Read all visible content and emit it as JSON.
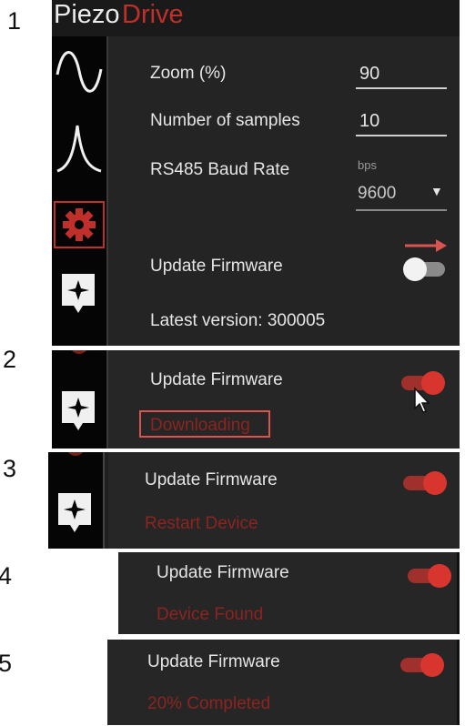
{
  "steps": [
    "1",
    "2",
    "3",
    "4",
    "5"
  ],
  "app": {
    "brand_first": "Piezo",
    "brand_second": "Drive",
    "brand_second_color": "#c0302b"
  },
  "sidebar": {
    "icons": [
      "sine-wave-icon",
      "peak-curve-icon",
      "gear-icon",
      "star-badge-icon"
    ],
    "active_icon": "gear-icon",
    "active_color": "#c0302b"
  },
  "settings": {
    "zoom_label": "Zoom (%)",
    "zoom_value": "90",
    "samples_label": "Number of samples",
    "samples_value": "10",
    "baud_label": "RS485 Baud Rate",
    "baud_unit": "bps",
    "baud_value": "9600",
    "firmware_label": "Update Firmware",
    "firmware_toggle_on": false,
    "latest_version": "Latest version: 300005"
  },
  "step2": {
    "firmware_label": "Update Firmware",
    "toggle_on": true,
    "status": "Downloading"
  },
  "step3": {
    "firmware_label": "Update Firmware",
    "toggle_on": true,
    "status": "Restart Device"
  },
  "step4": {
    "firmware_label": "Update Firmware",
    "toggle_on": true,
    "status": "Device Found"
  },
  "step5": {
    "firmware_label": "Update Firmware",
    "toggle_on": true,
    "status": "20% Completed"
  },
  "colors": {
    "accent_red": "#c0302b",
    "status_red": "#8c2420",
    "arrow_red": "#d9534f"
  }
}
